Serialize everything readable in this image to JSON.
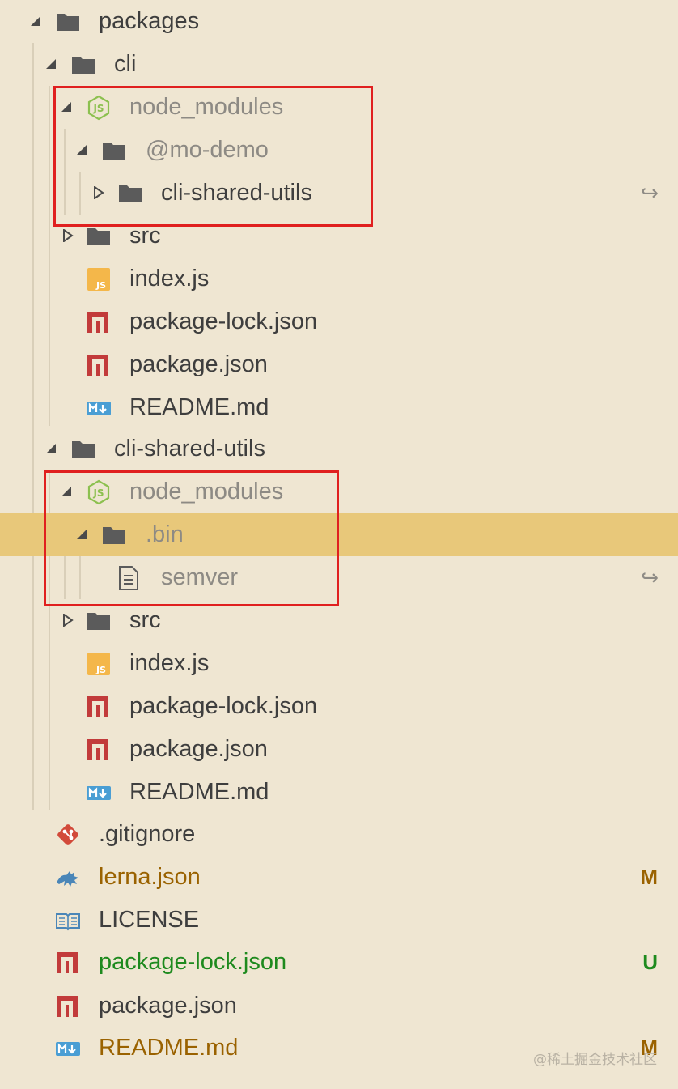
{
  "explorer": {
    "items": [
      {
        "label": "packages",
        "icon": "folder-icon",
        "expanded": true
      },
      {
        "label": "cli",
        "icon": "folder-icon",
        "expanded": true
      },
      {
        "label": "node_modules",
        "icon": "nodejs-icon",
        "expanded": true
      },
      {
        "label": "@mo-demo",
        "icon": "folder-icon",
        "expanded": true
      },
      {
        "label": "cli-shared-utils",
        "icon": "folder-icon",
        "expanded": false,
        "symlink": "↪"
      },
      {
        "label": "src",
        "icon": "folder-icon",
        "expanded": false
      },
      {
        "label": "index.js",
        "icon": "js-file-icon"
      },
      {
        "label": "package-lock.json",
        "icon": "npm-icon"
      },
      {
        "label": "package.json",
        "icon": "npm-icon"
      },
      {
        "label": "README.md",
        "icon": "markdown-icon"
      },
      {
        "label": "cli-shared-utils",
        "icon": "folder-icon",
        "expanded": true
      },
      {
        "label": "node_modules",
        "icon": "nodejs-icon",
        "expanded": true
      },
      {
        "label": ".bin",
        "icon": "folder-icon",
        "expanded": true,
        "selected": true
      },
      {
        "label": "semver",
        "icon": "text-file-icon",
        "symlink": "↪"
      },
      {
        "label": "src",
        "icon": "folder-icon",
        "expanded": false
      },
      {
        "label": "index.js",
        "icon": "js-file-icon"
      },
      {
        "label": "package-lock.json",
        "icon": "npm-icon"
      },
      {
        "label": "package.json",
        "icon": "npm-icon"
      },
      {
        "label": "README.md",
        "icon": "markdown-icon"
      },
      {
        "label": ".gitignore",
        "icon": "git-icon"
      },
      {
        "label": "lerna.json",
        "icon": "lerna-icon",
        "status": "M"
      },
      {
        "label": "LICENSE",
        "icon": "book-icon"
      },
      {
        "label": "package-lock.json",
        "icon": "npm-icon",
        "status": "U"
      },
      {
        "label": "package.json",
        "icon": "npm-icon"
      },
      {
        "label": "README.md",
        "icon": "markdown-icon",
        "status": "M"
      }
    ]
  },
  "watermark": "@稀土掘金技术社区",
  "colors": {
    "background": "#efe6d2",
    "selection": "#e8c87a",
    "highlight_box": "#e0201f",
    "modified": "#9a6200",
    "untracked": "#1e8a1e"
  }
}
